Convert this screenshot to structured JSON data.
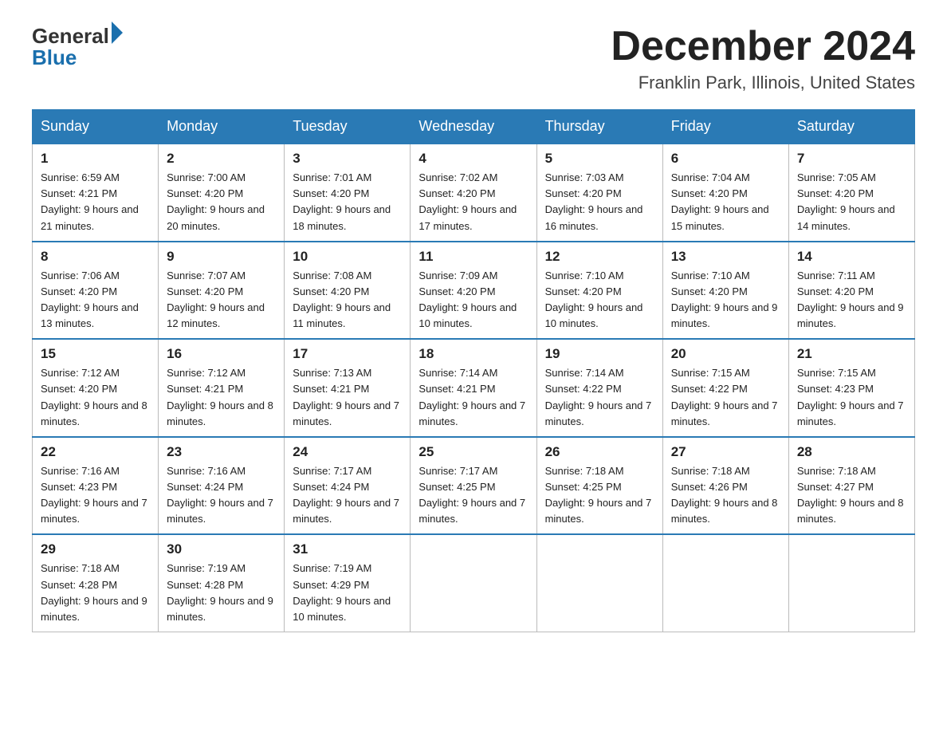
{
  "header": {
    "logo_general": "General",
    "logo_blue": "Blue",
    "month_year": "December 2024",
    "location": "Franklin Park, Illinois, United States"
  },
  "days_of_week": [
    "Sunday",
    "Monday",
    "Tuesday",
    "Wednesday",
    "Thursday",
    "Friday",
    "Saturday"
  ],
  "weeks": [
    [
      {
        "day": "1",
        "sunrise": "6:59 AM",
        "sunset": "4:21 PM",
        "daylight": "9 hours and 21 minutes."
      },
      {
        "day": "2",
        "sunrise": "7:00 AM",
        "sunset": "4:20 PM",
        "daylight": "9 hours and 20 minutes."
      },
      {
        "day": "3",
        "sunrise": "7:01 AM",
        "sunset": "4:20 PM",
        "daylight": "9 hours and 18 minutes."
      },
      {
        "day": "4",
        "sunrise": "7:02 AM",
        "sunset": "4:20 PM",
        "daylight": "9 hours and 17 minutes."
      },
      {
        "day": "5",
        "sunrise": "7:03 AM",
        "sunset": "4:20 PM",
        "daylight": "9 hours and 16 minutes."
      },
      {
        "day": "6",
        "sunrise": "7:04 AM",
        "sunset": "4:20 PM",
        "daylight": "9 hours and 15 minutes."
      },
      {
        "day": "7",
        "sunrise": "7:05 AM",
        "sunset": "4:20 PM",
        "daylight": "9 hours and 14 minutes."
      }
    ],
    [
      {
        "day": "8",
        "sunrise": "7:06 AM",
        "sunset": "4:20 PM",
        "daylight": "9 hours and 13 minutes."
      },
      {
        "day": "9",
        "sunrise": "7:07 AM",
        "sunset": "4:20 PM",
        "daylight": "9 hours and 12 minutes."
      },
      {
        "day": "10",
        "sunrise": "7:08 AM",
        "sunset": "4:20 PM",
        "daylight": "9 hours and 11 minutes."
      },
      {
        "day": "11",
        "sunrise": "7:09 AM",
        "sunset": "4:20 PM",
        "daylight": "9 hours and 10 minutes."
      },
      {
        "day": "12",
        "sunrise": "7:10 AM",
        "sunset": "4:20 PM",
        "daylight": "9 hours and 10 minutes."
      },
      {
        "day": "13",
        "sunrise": "7:10 AM",
        "sunset": "4:20 PM",
        "daylight": "9 hours and 9 minutes."
      },
      {
        "day": "14",
        "sunrise": "7:11 AM",
        "sunset": "4:20 PM",
        "daylight": "9 hours and 9 minutes."
      }
    ],
    [
      {
        "day": "15",
        "sunrise": "7:12 AM",
        "sunset": "4:20 PM",
        "daylight": "9 hours and 8 minutes."
      },
      {
        "day": "16",
        "sunrise": "7:12 AM",
        "sunset": "4:21 PM",
        "daylight": "9 hours and 8 minutes."
      },
      {
        "day": "17",
        "sunrise": "7:13 AM",
        "sunset": "4:21 PM",
        "daylight": "9 hours and 7 minutes."
      },
      {
        "day": "18",
        "sunrise": "7:14 AM",
        "sunset": "4:21 PM",
        "daylight": "9 hours and 7 minutes."
      },
      {
        "day": "19",
        "sunrise": "7:14 AM",
        "sunset": "4:22 PM",
        "daylight": "9 hours and 7 minutes."
      },
      {
        "day": "20",
        "sunrise": "7:15 AM",
        "sunset": "4:22 PM",
        "daylight": "9 hours and 7 minutes."
      },
      {
        "day": "21",
        "sunrise": "7:15 AM",
        "sunset": "4:23 PM",
        "daylight": "9 hours and 7 minutes."
      }
    ],
    [
      {
        "day": "22",
        "sunrise": "7:16 AM",
        "sunset": "4:23 PM",
        "daylight": "9 hours and 7 minutes."
      },
      {
        "day": "23",
        "sunrise": "7:16 AM",
        "sunset": "4:24 PM",
        "daylight": "9 hours and 7 minutes."
      },
      {
        "day": "24",
        "sunrise": "7:17 AM",
        "sunset": "4:24 PM",
        "daylight": "9 hours and 7 minutes."
      },
      {
        "day": "25",
        "sunrise": "7:17 AM",
        "sunset": "4:25 PM",
        "daylight": "9 hours and 7 minutes."
      },
      {
        "day": "26",
        "sunrise": "7:18 AM",
        "sunset": "4:25 PM",
        "daylight": "9 hours and 7 minutes."
      },
      {
        "day": "27",
        "sunrise": "7:18 AM",
        "sunset": "4:26 PM",
        "daylight": "9 hours and 8 minutes."
      },
      {
        "day": "28",
        "sunrise": "7:18 AM",
        "sunset": "4:27 PM",
        "daylight": "9 hours and 8 minutes."
      }
    ],
    [
      {
        "day": "29",
        "sunrise": "7:18 AM",
        "sunset": "4:28 PM",
        "daylight": "9 hours and 9 minutes."
      },
      {
        "day": "30",
        "sunrise": "7:19 AM",
        "sunset": "4:28 PM",
        "daylight": "9 hours and 9 minutes."
      },
      {
        "day": "31",
        "sunrise": "7:19 AM",
        "sunset": "4:29 PM",
        "daylight": "9 hours and 10 minutes."
      },
      null,
      null,
      null,
      null
    ]
  ]
}
